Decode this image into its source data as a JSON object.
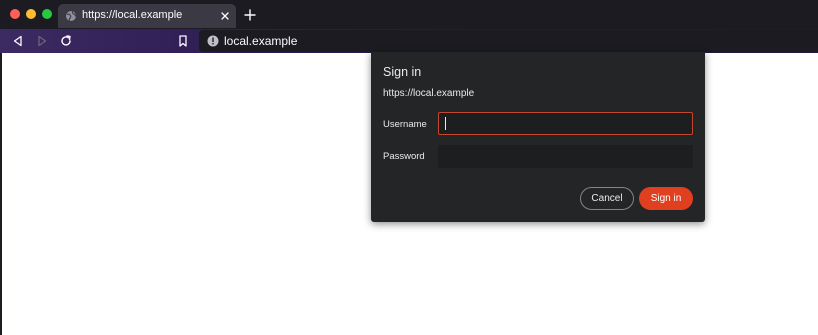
{
  "window": {
    "tab_title": "https://local.example",
    "url": "local.example",
    "icons": [
      "globe-icon",
      "close-icon",
      "plus-icon",
      "back-arrow-icon",
      "forward-arrow-icon",
      "reload-icon",
      "bookmark-icon",
      "info-icon"
    ]
  },
  "dialog": {
    "title": "Sign in",
    "origin": "https://local.example",
    "username_label": "Username",
    "username_value": "",
    "password_label": "Password",
    "password_value": "",
    "cancel_label": "Cancel",
    "signin_label": "Sign in"
  },
  "colors": {
    "titlebar": "#1c1b22",
    "tab": "#3b3a44",
    "dialog_bg": "#232527",
    "accent": "#e0401f",
    "focus_border": "#c4462b",
    "close_dot": "#ff5f57",
    "min_dot": "#febc2e",
    "max_dot": "#28c840"
  }
}
